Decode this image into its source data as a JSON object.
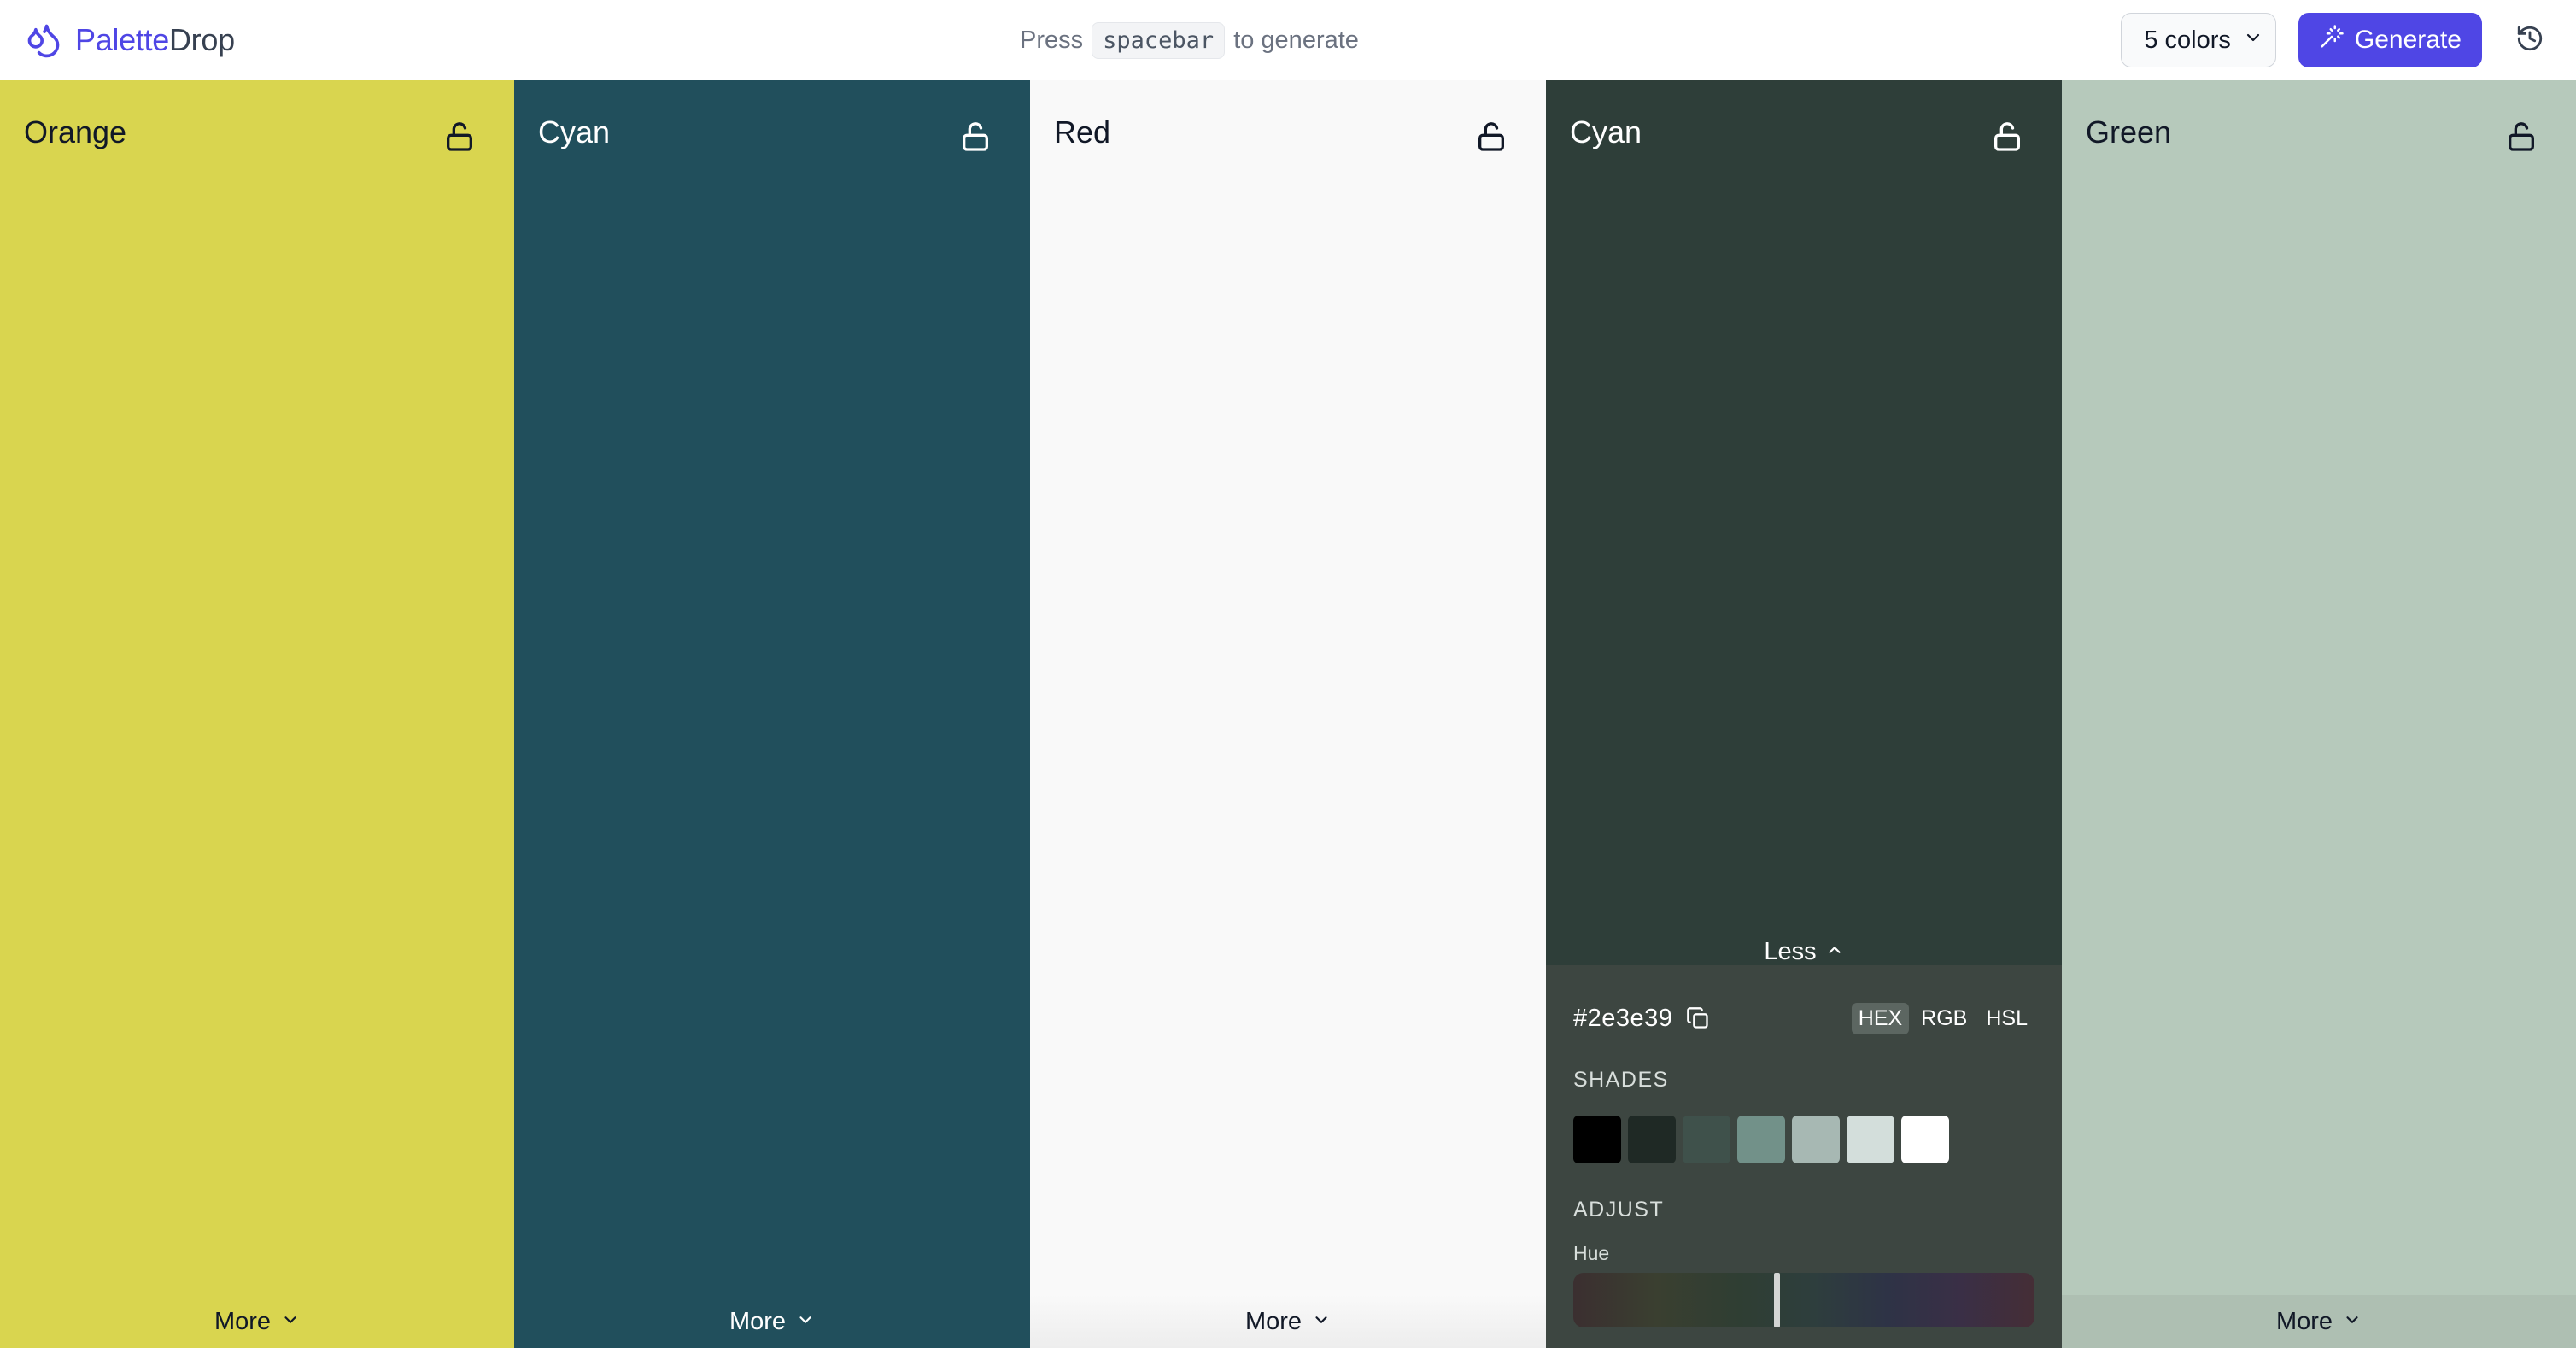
{
  "header": {
    "logo_part1": "Palette",
    "logo_part2": "Drop",
    "hint_prefix": "Press",
    "hint_key": "spacebar",
    "hint_suffix": "to generate",
    "count_select": "5 colors",
    "generate_label": "Generate"
  },
  "palette": [
    {
      "name": "Orange",
      "color": "#d9d54f",
      "text_color": "#111827",
      "more_label": "More"
    },
    {
      "name": "Cyan",
      "color": "#214f5c",
      "text_color": "#ffffff",
      "more_label": "More"
    },
    {
      "name": "Red",
      "color": "#f9f9f9",
      "text_color": "#111827",
      "more_label": "More"
    },
    {
      "name": "Cyan",
      "color": "#2e3e39",
      "text_color": "#ffffff",
      "less_label": "Less",
      "hex": "#2e3e39",
      "formats": [
        "HEX",
        "RGB",
        "HSL"
      ],
      "active_format": "HEX",
      "shades_label": "SHADES",
      "shades": [
        "#000000",
        "#1f2925",
        "#3f514b",
        "#729189",
        "#a7b8b3",
        "#d3dedb",
        "#ffffff"
      ],
      "adjust_label": "ADJUST",
      "hue_label": "Hue",
      "hue_position": 0.44
    },
    {
      "name": "Green",
      "color": "#b6c9bb",
      "text_color": "#111827",
      "more_label": "More"
    }
  ],
  "icons": {
    "logo": "drop-icon",
    "lock": "unlock-icon",
    "chevron_down": "chevron-down-icon",
    "chevron_up": "chevron-up-icon",
    "copy": "copy-icon",
    "wand": "magic-wand-icon",
    "history": "history-icon"
  }
}
